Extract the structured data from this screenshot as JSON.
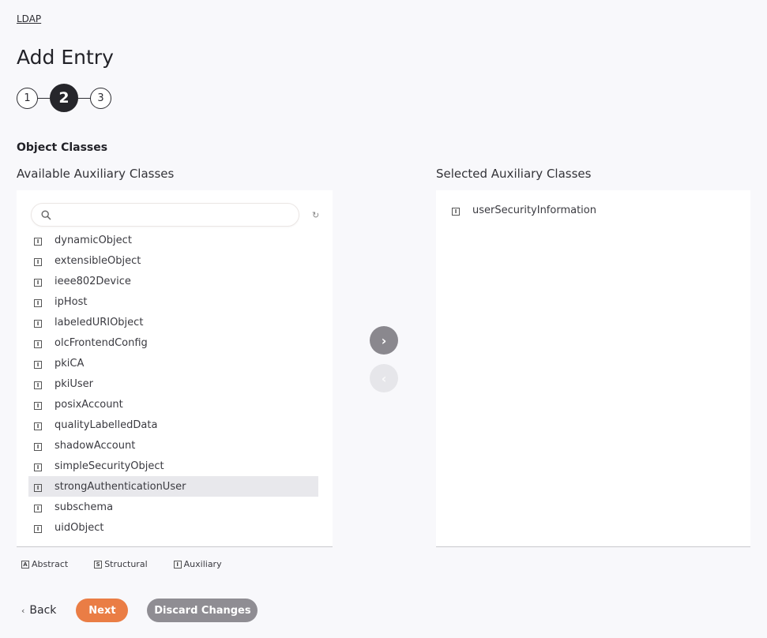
{
  "breadcrumb": "LDAP",
  "page_title": "Add Entry",
  "stepper": {
    "steps": [
      "1",
      "2",
      "3"
    ],
    "active_step": 2
  },
  "section_title": "Object Classes",
  "available": {
    "label": "Available Auxiliary Classes",
    "search_placeholder": "",
    "items": [
      "dynamicObject",
      "extensibleObject",
      "ieee802Device",
      "ipHost",
      "labeledURIObject",
      "olcFrontendConfig",
      "pkiCA",
      "pkiUser",
      "posixAccount",
      "qualityLabelledData",
      "shadowAccount",
      "simpleSecurityObject",
      "strongAuthenticationUser",
      "subschema",
      "uidObject"
    ],
    "highlighted_item": "strongAuthenticationUser"
  },
  "selected": {
    "label": "Selected Auxiliary Classes",
    "items": [
      "userSecurityInformation"
    ]
  },
  "type_icon_glyph": "I",
  "legend": [
    {
      "glyph": "A",
      "label": "Abstract"
    },
    {
      "glyph": "S",
      "label": "Structural"
    },
    {
      "glyph": "I",
      "label": "Auxiliary"
    }
  ],
  "move_right_glyph": "›",
  "move_left_glyph": "‹",
  "footer": {
    "back_label": "Back",
    "back_glyph": "‹",
    "next_label": "Next",
    "discard_label": "Discard Changes"
  },
  "colors": {
    "primary": "#ea7d45",
    "secondary": "#8f8d93",
    "step_active": "#26262b"
  }
}
